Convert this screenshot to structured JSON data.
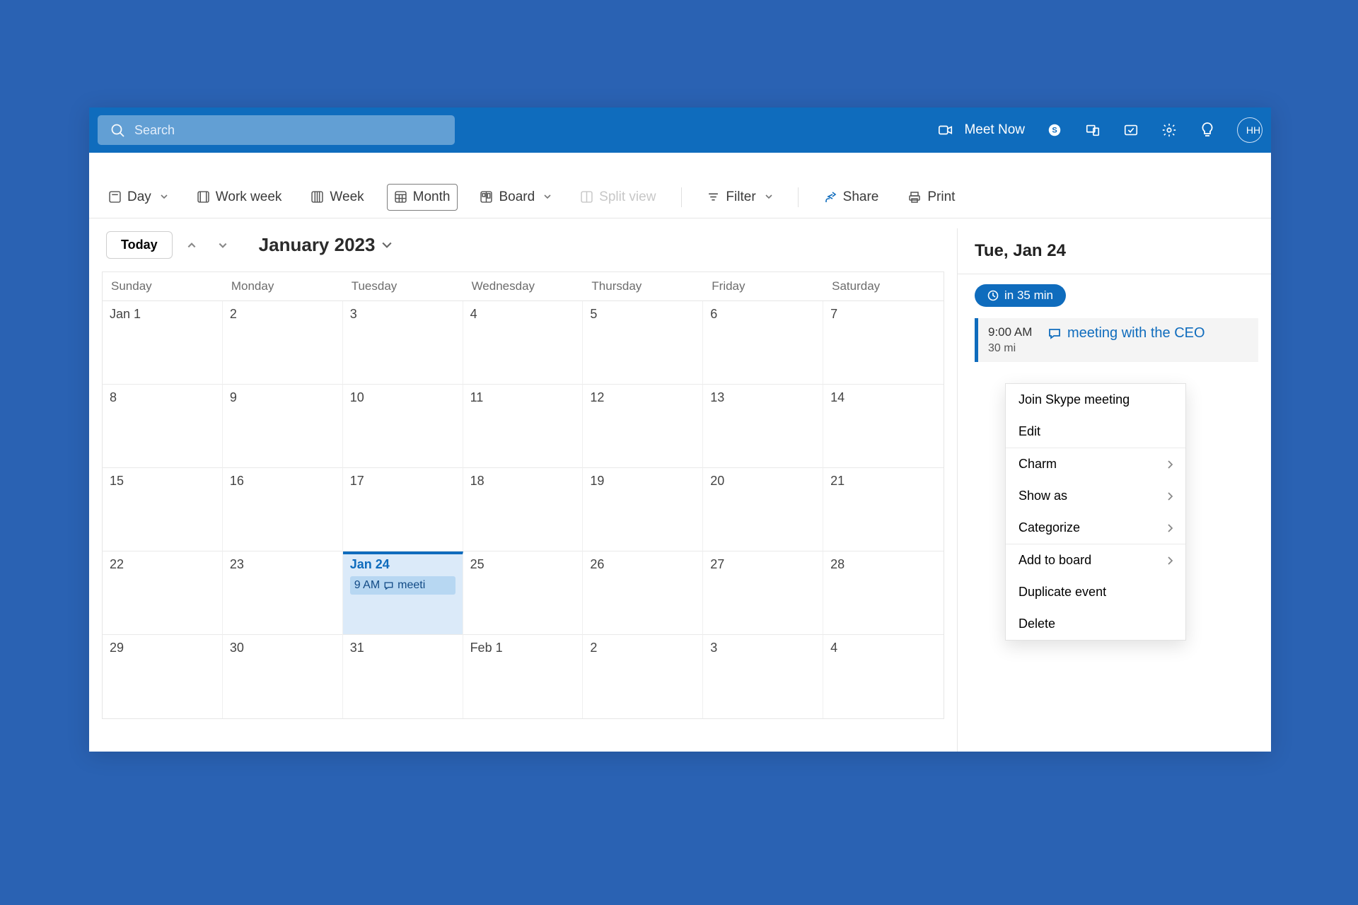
{
  "navbar": {
    "search_placeholder": "Search",
    "meet_now_label": "Meet Now",
    "avatar_initials": "HH"
  },
  "toolbar": {
    "day": "Day",
    "work_week": "Work week",
    "week": "Week",
    "month": "Month",
    "board": "Board",
    "split_view": "Split view",
    "filter": "Filter",
    "share": "Share",
    "print": "Print"
  },
  "calendar": {
    "today_label": "Today",
    "month_label": "January 2023",
    "dow": [
      "Sunday",
      "Monday",
      "Tuesday",
      "Wednesday",
      "Thursday",
      "Friday",
      "Saturday"
    ],
    "weeks": [
      [
        "Jan 1",
        "2",
        "3",
        "4",
        "5",
        "6",
        "7"
      ],
      [
        "8",
        "9",
        "10",
        "11",
        "12",
        "13",
        "14"
      ],
      [
        "15",
        "16",
        "17",
        "18",
        "19",
        "20",
        "21"
      ],
      [
        "22",
        "23",
        "Jan 24",
        "25",
        "26",
        "27",
        "28"
      ],
      [
        "29",
        "30",
        "31",
        "Feb 1",
        "2",
        "3",
        "4"
      ]
    ],
    "selected": {
      "week": 3,
      "col": 2
    },
    "selected_event": {
      "time": "9 AM",
      "title": "meeti"
    }
  },
  "side": {
    "date_label": "Tue, Jan 24",
    "countdown": "in 35 min",
    "event": {
      "time": "9:00 AM",
      "duration": "30 mi",
      "title": "meeting with the CEO"
    }
  },
  "menu": {
    "items": [
      {
        "label": "Join Skype meeting",
        "sub": false
      },
      {
        "label": "Edit",
        "sub": false,
        "sep_after": true
      },
      {
        "label": "Charm",
        "sub": true
      },
      {
        "label": "Show as",
        "sub": true
      },
      {
        "label": "Categorize",
        "sub": true,
        "sep_after": true
      },
      {
        "label": "Add to board",
        "sub": true
      },
      {
        "label": "Duplicate event",
        "sub": false
      },
      {
        "label": "Delete",
        "sub": false
      }
    ]
  }
}
